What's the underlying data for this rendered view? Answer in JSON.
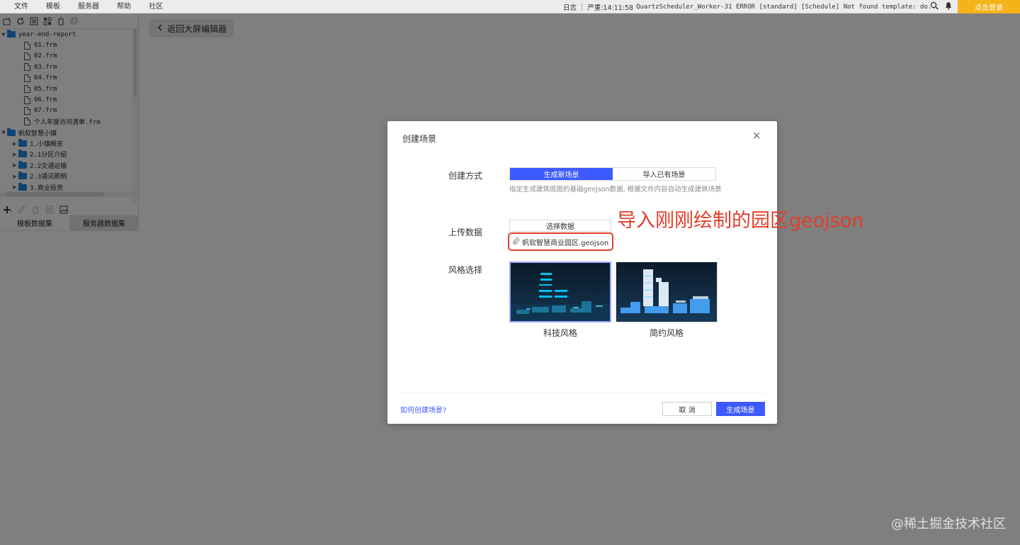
{
  "menu": {
    "items": [
      "文件",
      "模板",
      "服务器",
      "帮助",
      "社区"
    ]
  },
  "status": {
    "log_label": "日志",
    "level": "严重:14:11:58",
    "message": "QuartzScheduler_Worker-31 ERROR [standard] [Schedule] Not found template: do..."
  },
  "top_icons": [
    "search-icon",
    "bell-icon"
  ],
  "login_label": "点击登录",
  "tree": {
    "items": [
      {
        "type": "folder",
        "label": "year-end-report",
        "expanded": true,
        "level": 0
      },
      {
        "type": "file",
        "label": "01.frm",
        "level": 1
      },
      {
        "type": "file",
        "label": "02.frm",
        "level": 1
      },
      {
        "type": "file",
        "label": "03.frm",
        "level": 1
      },
      {
        "type": "file",
        "label": "04.frm",
        "level": 1
      },
      {
        "type": "file",
        "label": "05.frm",
        "level": 1
      },
      {
        "type": "file",
        "label": "06.frm",
        "level": 1
      },
      {
        "type": "file",
        "label": "07.frm",
        "level": 1
      },
      {
        "type": "file",
        "label": "个人年度访问清单.frm",
        "level": 1
      },
      {
        "type": "folder",
        "label": "帆软智慧小镇",
        "expanded": true,
        "level": 0
      },
      {
        "type": "folder",
        "label": "1.小镇概览",
        "expanded": false,
        "level": 1
      },
      {
        "type": "folder",
        "label": "2.1分区介绍",
        "expanded": false,
        "level": 1
      },
      {
        "type": "folder",
        "label": "2.2交通运输",
        "expanded": false,
        "level": 1
      },
      {
        "type": "folder",
        "label": "2.3通讯照明",
        "expanded": false,
        "level": 1
      },
      {
        "type": "folder",
        "label": "3.商业投资",
        "expanded": false,
        "level": 1
      }
    ]
  },
  "dataset_tabs": [
    "模板数据集",
    "服务器数据集"
  ],
  "back_button": "返回大屏编辑器",
  "dialog": {
    "title": "创建场景",
    "close": "×",
    "create_mode_label": "创建方式",
    "mode_options": [
      "生成新场景",
      "导入已有场景"
    ],
    "hint": "指定生成建筑底图的基础geojson数据, 根据文件内容自动生成建筑场景",
    "upload_label": "上传数据",
    "select_button": "选择数据",
    "uploaded_file": "帆软智慧商业园区.geojson",
    "annotation": "导入刚刚绘制的园区geojson",
    "style_label": "风格选择",
    "styles": [
      "科技风格",
      "简约风格"
    ],
    "help_link": "如何创建场景?",
    "cancel": "取 消",
    "confirm": "生成场景"
  },
  "watermark": "@稀土掘金技术社区",
  "colors": {
    "accent": "#3d5afe",
    "annotation": "#e23d2a",
    "login": "#f5b31a",
    "folder": "#1e88e5"
  }
}
